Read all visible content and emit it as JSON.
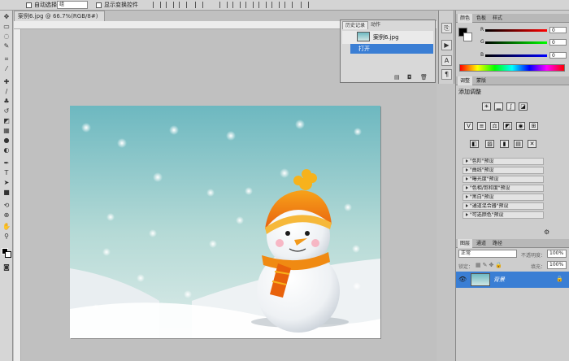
{
  "options_bar": {
    "auto_select_label": "自动选择：",
    "auto_select_value": "组",
    "show_transform_label": "显示变换控件"
  },
  "document": {
    "tab_title": "案例6.jpg @ 66.7%(RGB/8#)"
  },
  "history_panel": {
    "tabs": [
      "历史记录",
      "动作"
    ],
    "snapshot_name": "案例6.jpg",
    "step_open": "打开"
  },
  "color_panel": {
    "tabs": [
      "颜色",
      "色板",
      "样式"
    ],
    "channels": [
      {
        "label": "R",
        "value": "0"
      },
      {
        "label": "G",
        "value": "0"
      },
      {
        "label": "B",
        "value": "0"
      }
    ]
  },
  "adjust_panel": {
    "tabs": [
      "调整",
      "蒙版"
    ],
    "title": "添加调整",
    "presets": [
      "\"色阶\"预设",
      "\"曲线\"预设",
      "\"曝光度\"预设",
      "\"色相/饱和度\"预设",
      "\"黑白\"预设",
      "\"通道混合器\"预设",
      "\"可选颜色\"预设"
    ]
  },
  "layers_panel": {
    "tabs": [
      "图层",
      "通道",
      "路径"
    ],
    "blend_mode": "正常",
    "opacity_label": "不透明度：",
    "opacity_value": "100%",
    "lock_label": "锁定：",
    "fill_label": "填充：",
    "fill_value": "100%",
    "layer_name": "背景"
  },
  "colors": {
    "accent": "#3a7ed4",
    "canvas_top": "#6db8c0",
    "canvas_bottom": "#dcebe9"
  }
}
